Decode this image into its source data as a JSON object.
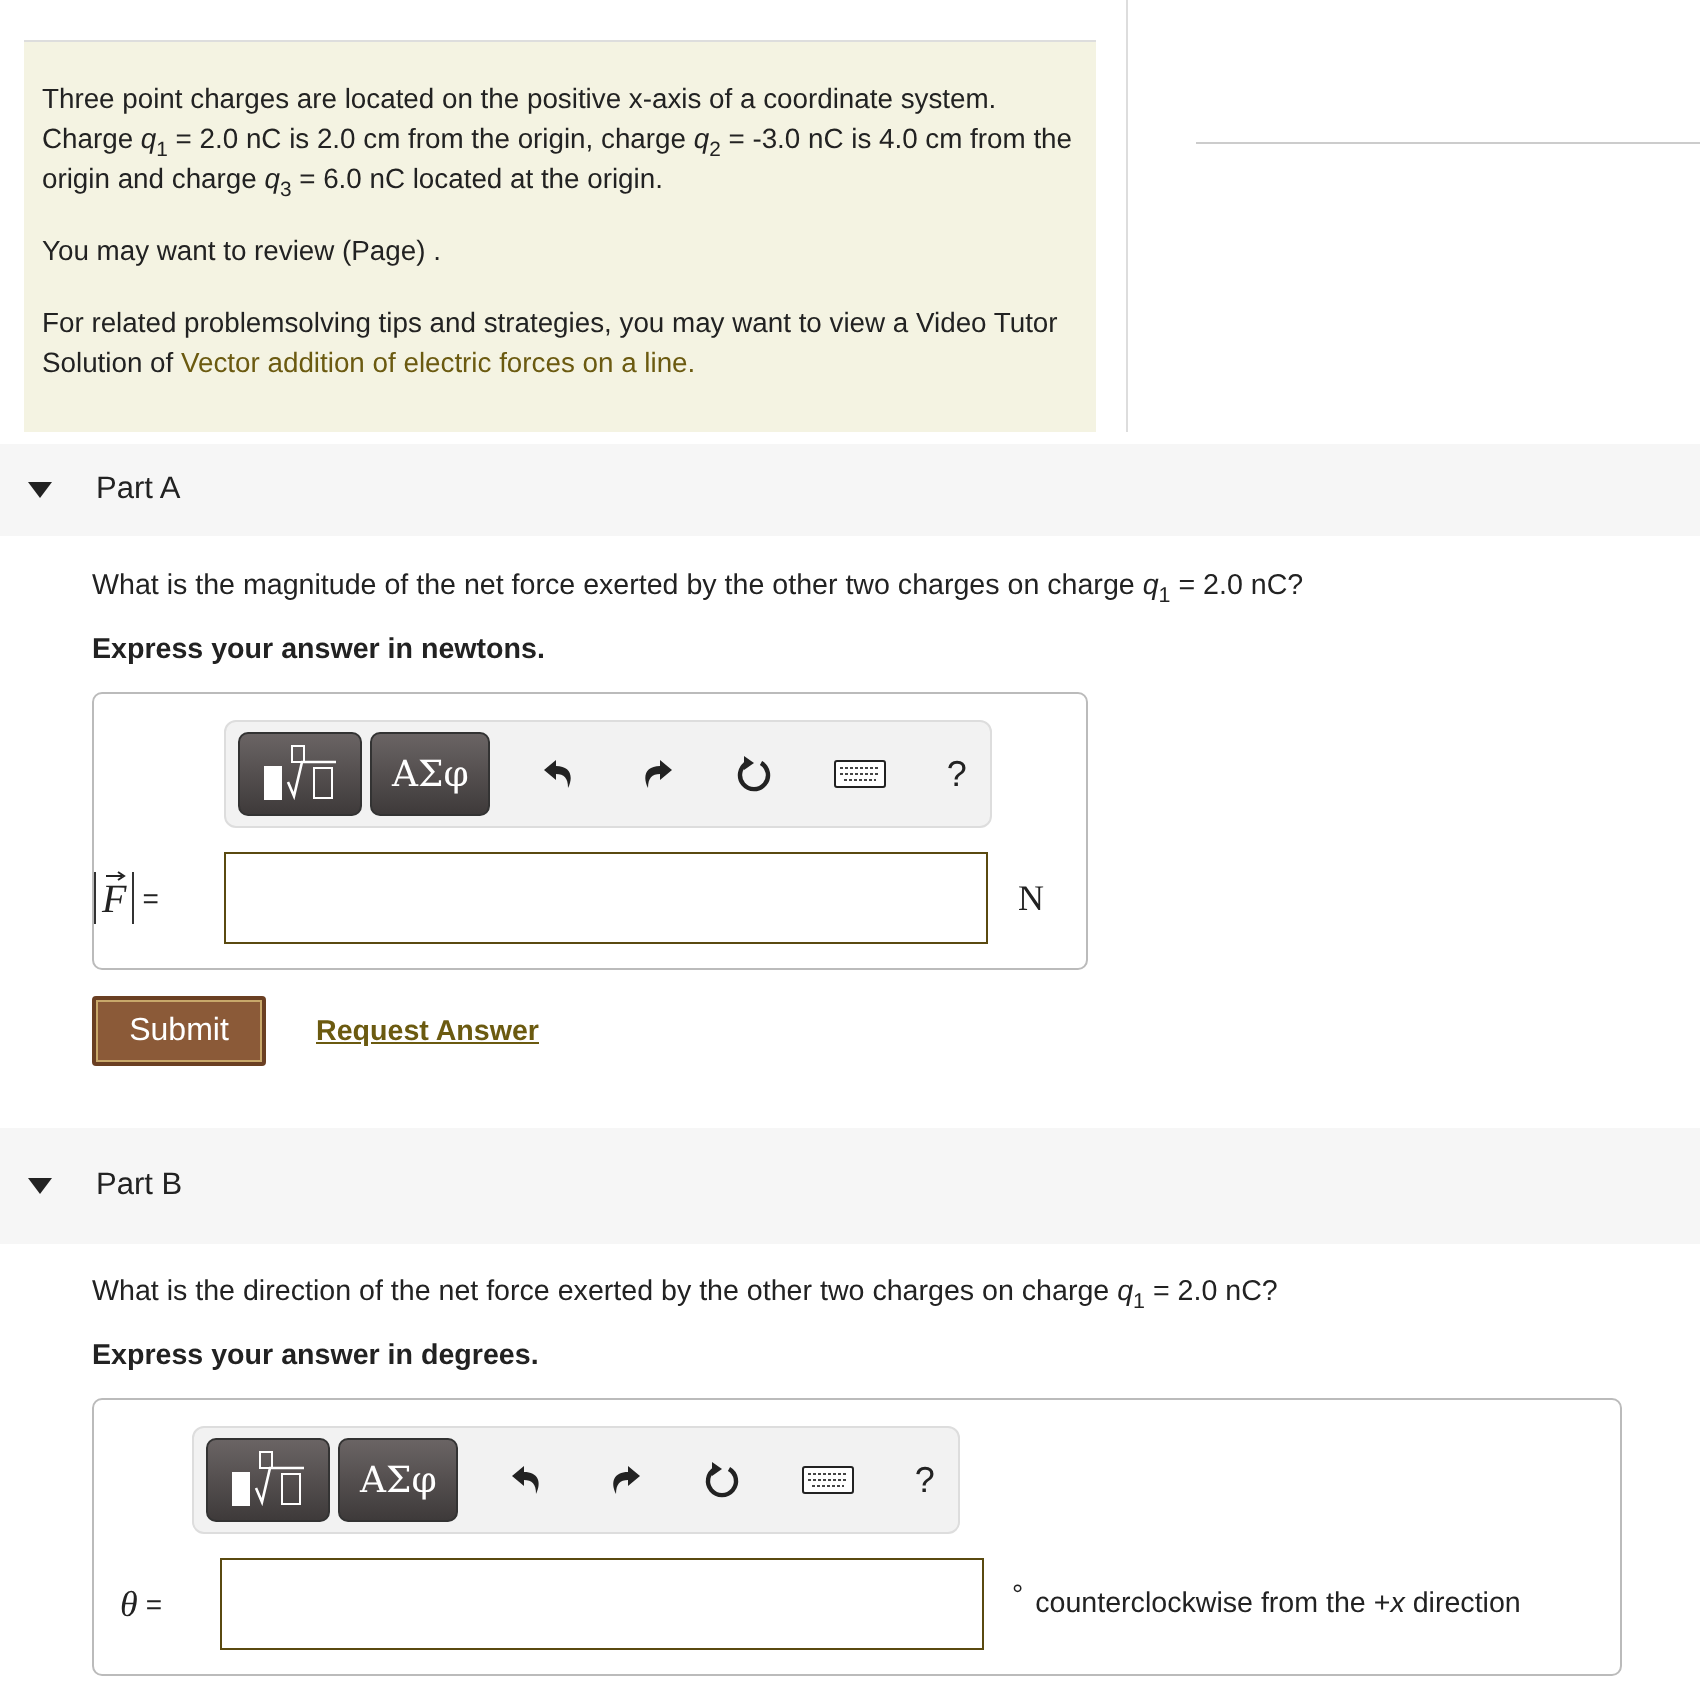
{
  "intro": {
    "paragraphs": [
      "Three point charges are located on the positive x-axis of a coordinate system. Charge *q*$_{1}$ = 2.0 nC is 2.0 cm from the origin, charge *q*$_{2}$ = -3.0 nC is 4.0 cm from the origin and charge *q*$_{3}$ = 6.0 nC located at the origin.",
      "You may want to review (Page) ."
    ],
    "tip": "For related problemsolving tips and strategies, you may want to view a Video Tutor Solution of",
    "tip_link": "Vector addition of electric forces on a line."
  },
  "parts": [
    {
      "label": "Part A",
      "expanded": true,
      "question": "What is the magnitude of the net force exerted by the other two charges on charge *q*$_{1}$ = 2.0 nC?",
      "instruction": "Express your answer in newtons.",
      "toolbar": {
        "symbols": "ΑΣφ",
        "help": "?"
      },
      "answer": {
        "kind": "vector",
        "symbol": "F",
        "equals": "=",
        "unit": "N"
      },
      "submit": "Submit",
      "request": "Request Answer"
    },
    {
      "label": "Part B",
      "expanded": true,
      "question": "What is the direction of the net force exerted by the other two charges on charge *q*$_{1}$ = 2.0 nC?",
      "instruction": "Express your answer in degrees.",
      "toolbar": {
        "symbols": "ΑΣφ",
        "help": "?"
      },
      "answer": {
        "kind": "scalar",
        "symbol": "θ",
        "equals": "=",
        "degree": "°",
        "unit": "counterclockwise from the +*x* direction"
      }
    }
  ]
}
